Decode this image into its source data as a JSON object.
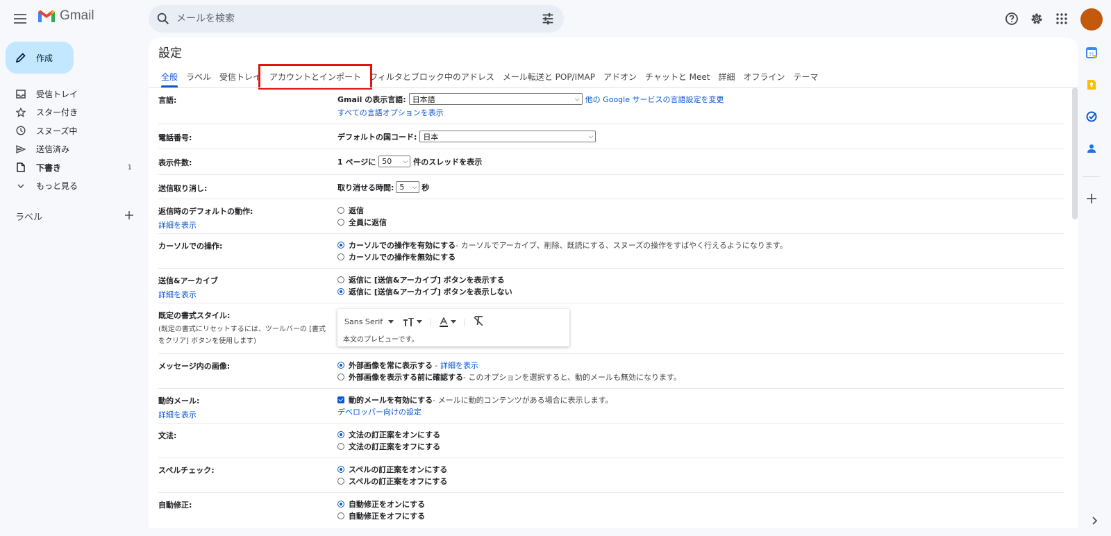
{
  "app": {
    "name": "Gmail"
  },
  "search": {
    "placeholder": "メールを検索"
  },
  "compose": {
    "label": "作成"
  },
  "nav": {
    "items": [
      {
        "label": "受信トレイ",
        "icon": "inbox-icon",
        "count": ""
      },
      {
        "label": "スター付き",
        "icon": "star-icon",
        "count": ""
      },
      {
        "label": "スヌーズ中",
        "icon": "clock-icon",
        "count": ""
      },
      {
        "label": "送信済み",
        "icon": "send-icon",
        "count": ""
      },
      {
        "label": "下書き",
        "icon": "draft-icon",
        "count": "1",
        "bold": true
      },
      {
        "label": "もっと見る",
        "icon": "chevron-down-icon",
        "count": ""
      }
    ],
    "labels_heading": "ラベル"
  },
  "settings": {
    "title": "設定",
    "tabs": [
      {
        "label": "全般",
        "active": true
      },
      {
        "label": "ラベル"
      },
      {
        "label": "受信トレイ"
      },
      {
        "label": "アカウントとインポート",
        "highlighted": true
      },
      {
        "label": "フィルタとブロック中のアドレス"
      },
      {
        "label": "メール転送と POP/IMAP"
      },
      {
        "label": "アドオン"
      },
      {
        "label": "チャットと Meet"
      },
      {
        "label": "詳細"
      },
      {
        "label": "オフライン"
      },
      {
        "label": "テーマ"
      }
    ],
    "language": {
      "label": "言語:",
      "field_label": "Gmail の表示言語:",
      "value": "日本語",
      "link": "他の Google サービスの言語設定を変更",
      "all_options": "すべての言語オプションを表示"
    },
    "phone": {
      "label": "電話番号:",
      "field_label": "デフォルトの国コード:",
      "value": "日本"
    },
    "page_size": {
      "label": "表示件数:",
      "prefix": "1 ページに",
      "value": "50",
      "suffix": "件のスレッドを表示"
    },
    "undo_send": {
      "label": "送信取り消し:",
      "prefix": "取り消せる時間:",
      "value": "5",
      "suffix": "秒"
    },
    "reply_default": {
      "label": "返信時のデフォルトの動作:",
      "link": "詳細を表示",
      "options": [
        "返信",
        "全員に返信"
      ]
    },
    "hover_actions": {
      "label": "カーソルでの操作:",
      "option1": "カーソルでの操作を有効にする",
      "option1_desc": " - カーソルでアーカイブ、削除、既読にする、スヌーズの操作をすばやく行えるようになります。",
      "option2": "カーソルでの操作を無効にする"
    },
    "send_archive": {
      "label": "送信&アーカイブ",
      "link": "詳細を表示",
      "option1": "返信に [送信&アーカイブ] ボタンを表示する",
      "option2": "返信に [送信&アーカイブ] ボタンを表示しない"
    },
    "text_style": {
      "label": "既定の書式スタイル:",
      "note": "(既定の書式にリセットするには、ツールバーの [書式をクリア] ボタンを使用します)",
      "font": "Sans Serif",
      "preview": "本文のプレビューです。"
    },
    "images": {
      "label": "メッセージ内の画像:",
      "option1": "外部画像を常に表示する",
      "option1_link": "詳細を表示",
      "option2": "外部画像を表示する前に確認する",
      "option2_desc": " - このオプションを選択すると、動的メールも無効になります。"
    },
    "dynamic_email": {
      "label": "動的メール:",
      "link": "詳細を表示",
      "option": "動的メールを有効にする",
      "option_desc": " - メールに動的コンテンツがある場合に表示します。",
      "dev_link": "デベロッパー向けの設定"
    },
    "grammar": {
      "label": "文法:",
      "option1": "文法の訂正案をオンにする",
      "option2": "文法の訂正案をオフにする"
    },
    "spelling": {
      "label": "スペルチェック:",
      "option1": "スペルの訂正案をオンにする",
      "option2": "スペルの訂正案をオフにする"
    },
    "autocorrect": {
      "label": "自動修正:",
      "option1": "自動修正をオンにする",
      "option2": "自動修正をオフにする"
    }
  },
  "colors": {
    "accent": "#0b57d0",
    "compose_bg": "#c2e7ff",
    "highlight_box": "#e0150f",
    "avatar": "#c2590c"
  }
}
